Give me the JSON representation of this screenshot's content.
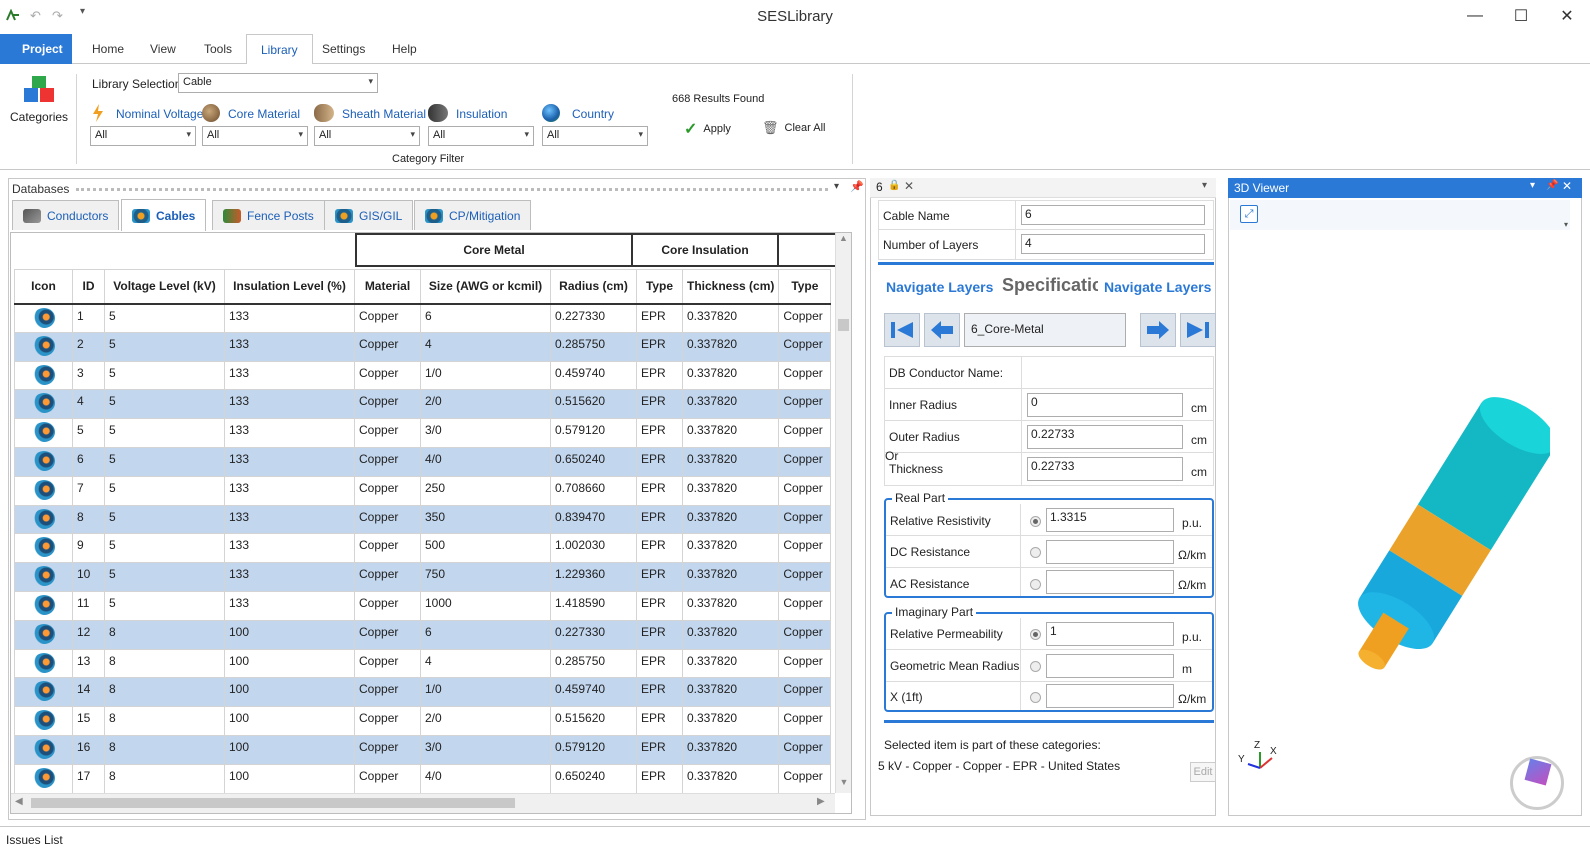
{
  "window": {
    "title": "SESLibrary"
  },
  "ribbon_tabs": [
    "Project",
    "Home",
    "View",
    "Tools",
    "Library",
    "Settings",
    "Help"
  ],
  "ribbon": {
    "categories_label": "Categories",
    "library_selection_label": "Library Selection:",
    "library_selection_value": "Cable",
    "filters": [
      {
        "label": "Nominal Voltage",
        "value": "All"
      },
      {
        "label": "Core Material",
        "value": "All"
      },
      {
        "label": "Sheath Material",
        "value": "All"
      },
      {
        "label": "Insulation",
        "value": "All"
      },
      {
        "label": "Country",
        "value": "All"
      }
    ],
    "results": "668 Results Found",
    "apply": "Apply",
    "clear_all": "Clear All",
    "group_label": "Category Filter"
  },
  "databases": {
    "title": "Databases",
    "tabs": [
      "Conductors",
      "Cables",
      "Fence Posts",
      "GIS/GIL",
      "CP/Mitigation"
    ],
    "group_headers": [
      "Core Metal",
      "Core Insulation"
    ],
    "columns": [
      "Icon",
      "ID",
      "Voltage Level (kV)",
      "Insulation Level (%)",
      "Material",
      "Size (AWG or kcmil)",
      "Radius (cm)",
      "Type",
      "Thickness (cm)",
      "Type"
    ],
    "rows": [
      [
        "1",
        "5",
        "133",
        "Copper",
        "6",
        "0.227330",
        "EPR",
        "0.337820",
        "Copper"
      ],
      [
        "2",
        "5",
        "133",
        "Copper",
        "4",
        "0.285750",
        "EPR",
        "0.337820",
        "Copper"
      ],
      [
        "3",
        "5",
        "133",
        "Copper",
        "1/0",
        "0.459740",
        "EPR",
        "0.337820",
        "Copper"
      ],
      [
        "4",
        "5",
        "133",
        "Copper",
        "2/0",
        "0.515620",
        "EPR",
        "0.337820",
        "Copper"
      ],
      [
        "5",
        "5",
        "133",
        "Copper",
        "3/0",
        "0.579120",
        "EPR",
        "0.337820",
        "Copper"
      ],
      [
        "6",
        "5",
        "133",
        "Copper",
        "4/0",
        "0.650240",
        "EPR",
        "0.337820",
        "Copper"
      ],
      [
        "7",
        "5",
        "133",
        "Copper",
        "250",
        "0.708660",
        "EPR",
        "0.337820",
        "Copper"
      ],
      [
        "8",
        "5",
        "133",
        "Copper",
        "350",
        "0.839470",
        "EPR",
        "0.337820",
        "Copper"
      ],
      [
        "9",
        "5",
        "133",
        "Copper",
        "500",
        "1.002030",
        "EPR",
        "0.337820",
        "Copper"
      ],
      [
        "10",
        "5",
        "133",
        "Copper",
        "750",
        "1.229360",
        "EPR",
        "0.337820",
        "Copper"
      ],
      [
        "11",
        "5",
        "133",
        "Copper",
        "1000",
        "1.418590",
        "EPR",
        "0.337820",
        "Copper"
      ],
      [
        "12",
        "8",
        "100",
        "Copper",
        "6",
        "0.227330",
        "EPR",
        "0.337820",
        "Copper"
      ],
      [
        "13",
        "8",
        "100",
        "Copper",
        "4",
        "0.285750",
        "EPR",
        "0.337820",
        "Copper"
      ],
      [
        "14",
        "8",
        "100",
        "Copper",
        "1/0",
        "0.459740",
        "EPR",
        "0.337820",
        "Copper"
      ],
      [
        "15",
        "8",
        "100",
        "Copper",
        "2/0",
        "0.515620",
        "EPR",
        "0.337820",
        "Copper"
      ],
      [
        "16",
        "8",
        "100",
        "Copper",
        "3/0",
        "0.579120",
        "EPR",
        "0.337820",
        "Copper"
      ],
      [
        "17",
        "8",
        "100",
        "Copper",
        "4/0",
        "0.650240",
        "EPR",
        "0.337820",
        "Copper"
      ]
    ]
  },
  "detail": {
    "tab_title": "6",
    "cable_name_label": "Cable Name",
    "cable_name_value": "6",
    "layers_label": "Number of Layers",
    "layers_value": "4",
    "nav_left": "Navigate Layers",
    "spec_title": "Specificatic",
    "nav_right": "Navigate Layers",
    "layer_value": "6_Core-Metal",
    "db_conductor_label": "DB Conductor Name:",
    "inner_radius_label": "Inner Radius",
    "inner_radius_value": "0",
    "outer_radius_label": "Outer Radius",
    "outer_radius_value": "0.22733",
    "or_label": "Or",
    "thickness_label": "Thickness",
    "thickness_value": "0.22733",
    "unit_cm": "cm",
    "real_part_label": "Real Part",
    "rel_resistivity_label": "Relative Resistivity",
    "rel_resistivity_value": "1.3315",
    "unit_pu": "p.u.",
    "dc_resistance_label": "DC Resistance",
    "ac_resistance_label": "AC Resistance",
    "unit_ohm_km": "Ω/km",
    "imag_part_label": "Imaginary Part",
    "rel_permeability_label": "Relative Permeability",
    "rel_permeability_value": "1",
    "gmr_label": "Geometric Mean Radius",
    "unit_m": "m",
    "x1ft_label": "X (1ft)",
    "categories_note": "Selected item is part of these categories:",
    "categories_value": "5 kV - Copper - Copper - EPR - United States",
    "edit": "Edit"
  },
  "viewer": {
    "title": "3D Viewer",
    "axis_x": "X",
    "axis_y": "Y",
    "axis_z": "Z"
  },
  "status": {
    "issues": "Issues List"
  },
  "colors": {
    "accent": "#2b79d6",
    "row_alt": "#c2d6ee",
    "cyan": "#19c8cf",
    "orange": "#f0a020",
    "blue": "#16aee0"
  }
}
